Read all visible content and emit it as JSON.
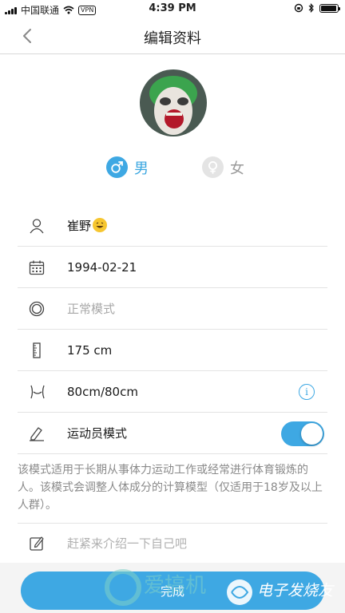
{
  "status_bar": {
    "carrier": "中国联通",
    "vpn": "VPN",
    "time": "4:39 PM",
    "battery_level": 0.95
  },
  "nav": {
    "title": "编辑资料"
  },
  "gender": {
    "male_label": "男",
    "female_label": "女",
    "selected": "male"
  },
  "fields": {
    "name": "崔野",
    "birthday": "1994-02-21",
    "mode_placeholder": "正常模式",
    "height": "175 cm",
    "waist_hip": "80cm/80cm",
    "athlete_mode_label": "运动员模式",
    "athlete_mode_on": true
  },
  "description": "该模式适用于长期从事体力运动工作或经常进行体育锻炼的人。该模式会调整人体成分的计算模型（仅适用于18岁及以上人群）。",
  "intro_placeholder": "赶紧来介绍一下自己吧",
  "done_label": "完成",
  "watermarks": {
    "left": "爱搞机",
    "right": "电子发烧友"
  },
  "colors": {
    "accent": "#3ea8e3",
    "placeholder": "#a8a8a8",
    "divider": "#e3e3e3"
  },
  "icons": [
    "back-chevron-icon",
    "person-icon",
    "calendar-icon",
    "target-icon",
    "ruler-icon",
    "waist-icon",
    "info-icon",
    "pen-icon",
    "edit-note-icon",
    "male-icon",
    "female-icon"
  ]
}
